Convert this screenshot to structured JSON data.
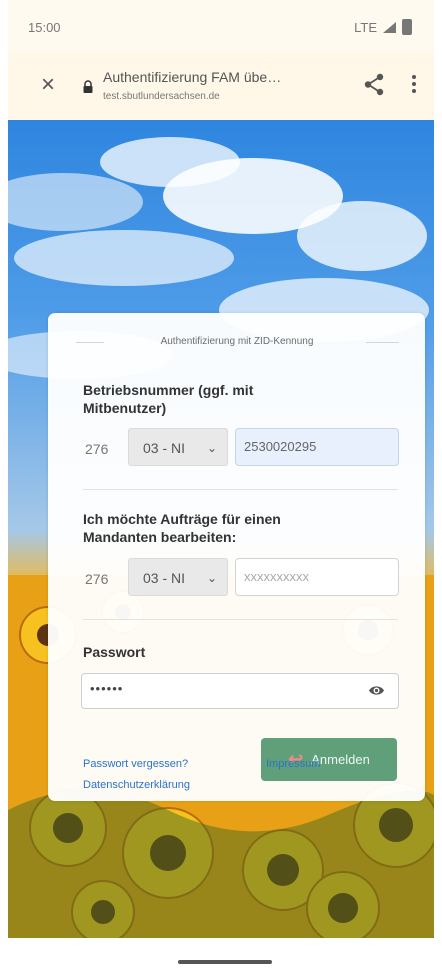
{
  "status_bar": {
    "time": "15:00",
    "network": "LTE"
  },
  "browser": {
    "title": "Authentifizierung FAM übe…",
    "url": "test.sbutlundersachsen.de"
  },
  "login_card": {
    "heading": "Authentifizierung mit ZID-Kennung",
    "business_number": {
      "label": "Betriebsnummer (ggf. mit Mitbenutzer)",
      "country_code": "276",
      "state_select": "03 - NI",
      "value": "2530020295"
    },
    "client_section": {
      "label": "Ich möchte Aufträge für einen Mandanten bearbeiten:",
      "country_code": "276",
      "state_select": "03 - NI",
      "placeholder": "xxxxxxxxxx"
    },
    "password": {
      "label": "Passwort",
      "value": "••••••"
    },
    "login_button": "Anmelden",
    "links": {
      "forgot_password": "Passwort vergessen?",
      "imprint": "Impressum",
      "privacy": "Datenschutzerklärung"
    }
  },
  "colors": {
    "sky": "#3f92e3",
    "sunflower": "#f2b522",
    "button": "#5f9f79",
    "link": "#2c73c7",
    "active_input": "#e8f0fe"
  },
  "icons": [
    "close-icon",
    "lock-icon",
    "share-icon",
    "menu-icon",
    "chevron-down-icon",
    "eye-icon",
    "login-icon"
  ]
}
